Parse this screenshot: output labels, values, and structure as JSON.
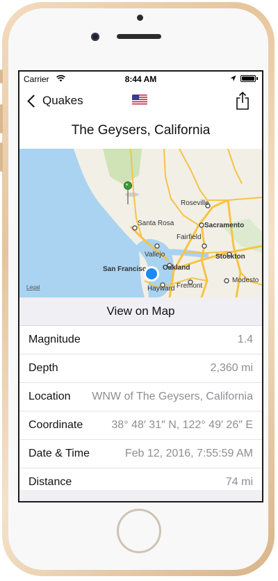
{
  "status_bar": {
    "carrier": "Carrier",
    "time": "8:44 AM"
  },
  "nav": {
    "back_label": "Quakes",
    "flag_icon": "us-flag-icon",
    "share_icon": "share-icon"
  },
  "title": "The Geysers, California",
  "map": {
    "labels": {
      "santa_rosa": "Santa Rosa",
      "roseville": "Roseville",
      "sacramento": "Sacramento",
      "fairfield": "Fairfield",
      "vallejo": "Vallejo",
      "stockton": "Stockton",
      "oakland": "Oakland",
      "san_francisco": "San Francisco",
      "hayward": "Hayward",
      "fremont": "Fremont",
      "modesto": "Modesto",
      "legal": "Legal"
    },
    "colors": {
      "water": "#a9d3f0",
      "land": "#f2efe6",
      "road": "#f6c344",
      "park": "#cfe3b6"
    }
  },
  "view_on_map_label": "View on Map",
  "details": [
    {
      "key": "Magnitude",
      "value": "1.4"
    },
    {
      "key": "Depth",
      "value": "2,360 mi"
    },
    {
      "key": "Location",
      "value": "WNW of The Geysers, California"
    },
    {
      "key": "Coordinate",
      "value": "38° 48′ 31″ N, 122° 49′ 26″ E"
    },
    {
      "key": "Date & Time",
      "value": "Feb 12, 2016, 7:55:59 AM"
    },
    {
      "key": "Distance",
      "value": "74 mi"
    }
  ]
}
